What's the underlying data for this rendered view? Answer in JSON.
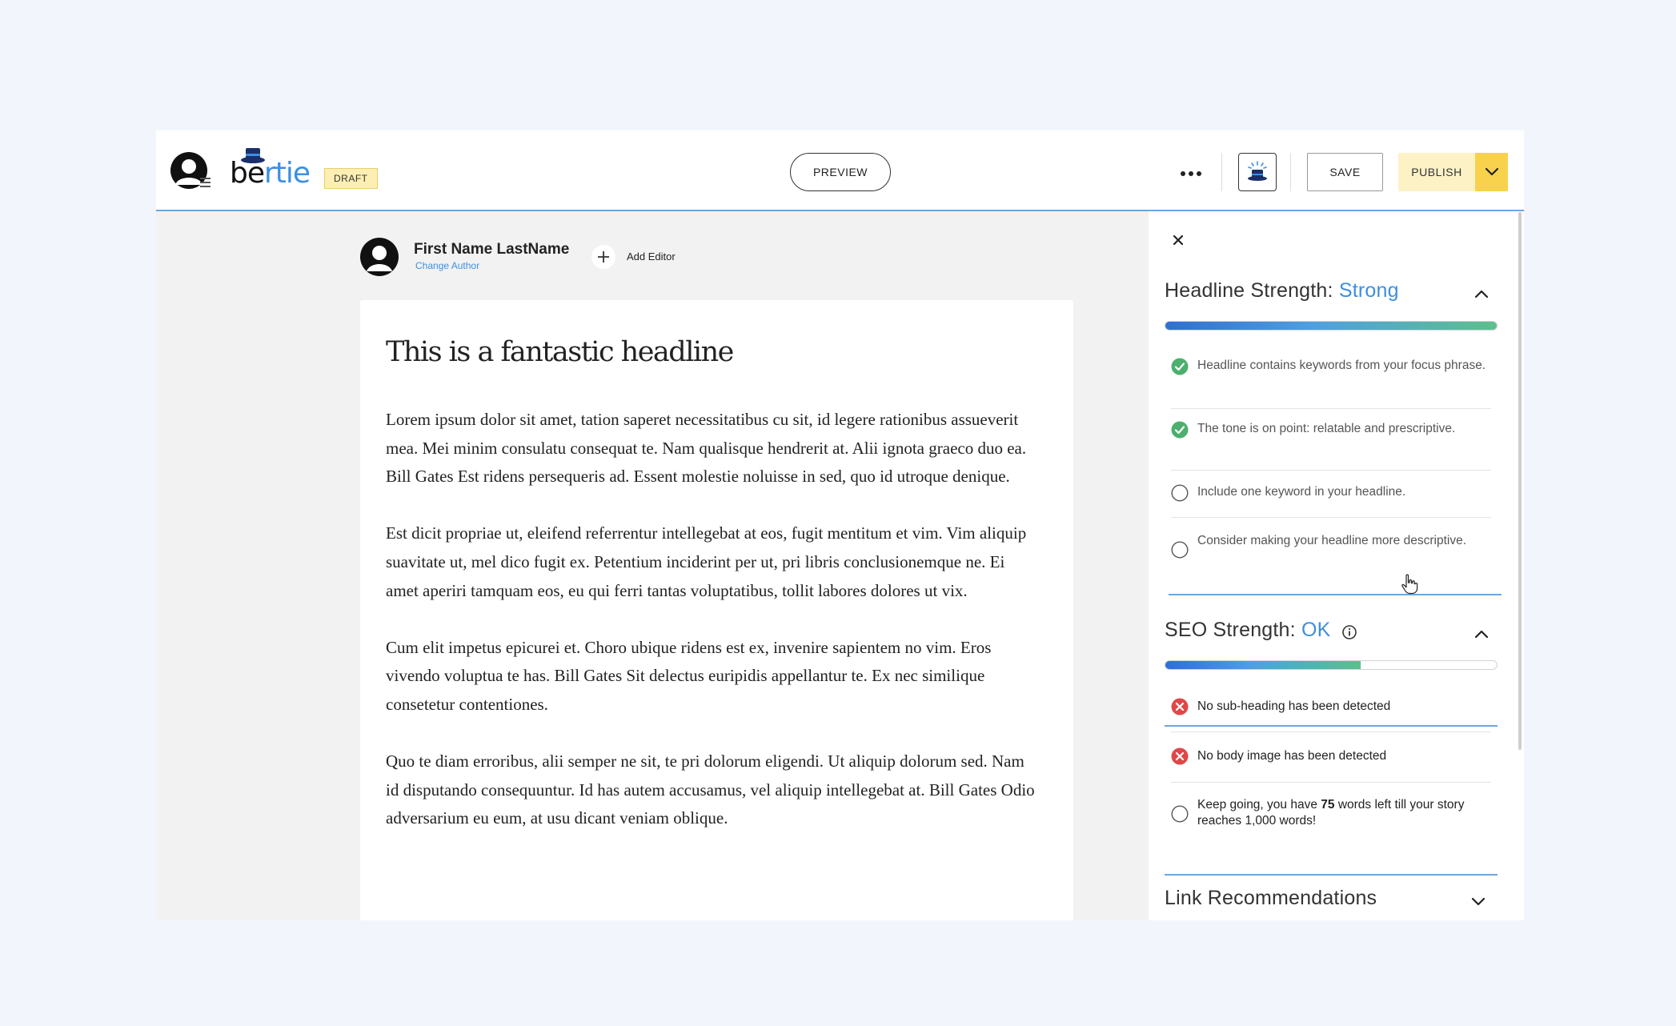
{
  "app": {
    "brand_part1": "be",
    "brand_part2": "rtie",
    "status_badge": "DRAFT",
    "preview_label": "PREVIEW",
    "save_label": "SAVE",
    "publish_label": "PUBLISH",
    "accent_color": "#3d8fe0"
  },
  "author": {
    "name": "First Name LastName",
    "change_label": "Change Author",
    "add_editor_label": "Add Editor"
  },
  "article": {
    "headline": "This is a fantastic headline",
    "paragraphs": [
      "Lorem ipsum dolor sit amet, tation saperet necessitatibus cu sit, id legere rationibus assueverit mea. Mei minim consulatu consequat te. Nam qualisque hendrerit at. Alii ignota graeco duo ea. Bill Gates Est ridens persequeris ad. Essent molestie noluisse in sed, quo id utroque denique.",
      "Est dicit propriae ut, eleifend referrentur intellegebat at eos, fugit mentitum et vim. Vim aliquip suavitate ut, mel dico fugit ex. Petentium inciderint per ut, pri libris conclusionemque ne. Ei amet aperiri tamquam eos, eu qui ferri tantas voluptatibus, tollit labores dolores ut vix.",
      "Cum elit impetus epicurei et. Choro ubique ridens est ex, invenire sapientem no vim. Eros vivendo voluptua te has. Bill Gates Sit delectus euripidis appellantur te. Ex nec similique consetetur contentiones.",
      "Quo te diam erroribus, alii semper ne sit, te pri dolorum eligendi. Ut aliquip dolorum sed. Nam id disputando consequuntur. Id has autem accusamus, vel aliquip intellegebat at. Bill Gates Odio adversarium eu eum, at usu dicant veniam oblique."
    ]
  },
  "panel": {
    "headline": {
      "label": "Headline Strength: ",
      "value": "Strong",
      "progress": 1.0,
      "items": [
        {
          "status": "pass",
          "text": "Headline contains keywords from your focus phrase."
        },
        {
          "status": "pass",
          "text": "The tone is on point: relatable and prescriptive."
        },
        {
          "status": "todo",
          "text": "Include one keyword in your headline."
        },
        {
          "status": "todo",
          "text": "Consider making your headline more descriptive."
        }
      ]
    },
    "seo": {
      "label": "SEO Strength: ",
      "value": "OK",
      "progress": 0.59,
      "items": [
        {
          "status": "fail",
          "text": "No sub-heading has been detected"
        },
        {
          "status": "fail",
          "text": "No body image has been detected"
        },
        {
          "status": "todo",
          "text_before": "Keep going, you have ",
          "text_bold": "75",
          "text_after": " words left till your story reaches 1,000 words!"
        }
      ]
    },
    "links": {
      "label": "Link Recommendations"
    }
  }
}
